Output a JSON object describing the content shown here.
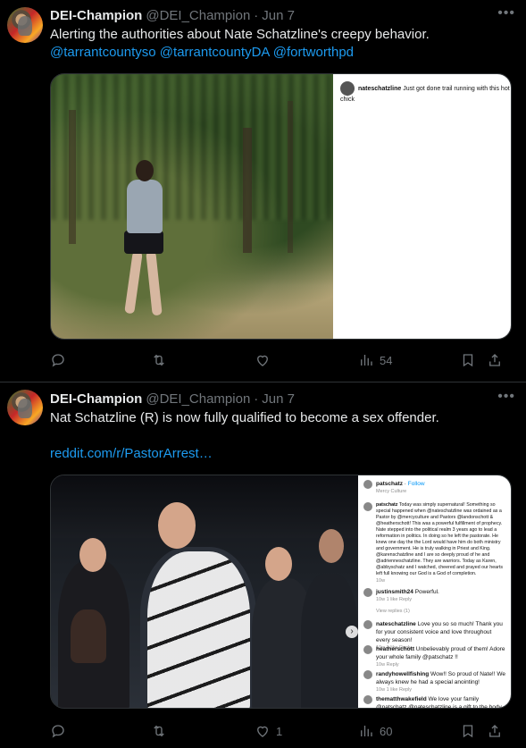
{
  "tweets": [
    {
      "author": {
        "name": "DEI-Champion",
        "handle": "@DEI_Champion",
        "separator": "·",
        "date": "Jun 7"
      },
      "text_plain": "Alerting the authorities about Nate Schatzline's creepy behavior.",
      "mentions": [
        "@tarrantcountyso",
        "@tarrantcountyDA",
        "@fortworthpd"
      ],
      "media": {
        "instagram_caption_user": "nateschatzline",
        "instagram_caption_text": "Just got done trail running with this hot chick"
      },
      "actions": {
        "reply_count": "",
        "retweet_count": "",
        "like_count": "",
        "views": "54"
      }
    },
    {
      "author": {
        "name": "DEI-Champion",
        "handle": "@DEI_Champion",
        "separator": "·",
        "date": "Jun 7"
      },
      "text_plain": "Nat Schatzline (R) is now fully qualified to become a sex offender.",
      "link": "reddit.com/r/PastorArrest…",
      "media": {
        "header_user": "patschatz",
        "header_follow": "Follow",
        "header_sub": "Mercy Culture",
        "caption_user": "patschatz",
        "caption_text": "Today was simply supernatural! Something so special happened when @nateschatzline was ordained as a Pastor by @mercyculture and Pastors @landonschott & @heatherschott! This was a powerful fulfillment of prophecy. Nate stepped into the political realm 3 years ago to lead a reformation in politics. In doing so he left the pastorate. He knew one day the the Lord would have him do both ministry and government. He is truly walking in Priest and King. @karenschatzline and I are so deeply proud of he and @adrienneschatzline. They are warriors. Today as Karen, @abbyschatz and I watched, cheered and prayed our hearts left full knowing our God is a God of completion.",
        "caption_meta": "10w",
        "comments": [
          {
            "user": "justinsmith24",
            "text": "Powerful.",
            "meta": "10w 1 like Reply"
          },
          {
            "user": "",
            "text": "View replies (1)",
            "meta": ""
          },
          {
            "user": "nateschatzline",
            "text": "Love you so so much! Thank you for your consistent voice and love throughout every season!",
            "meta": "10w 1 like Reply"
          },
          {
            "user": "heatherschott",
            "text": "Unbelievably proud of them! Adore your whole family @patschatz !!",
            "meta": "10w Reply"
          },
          {
            "user": "randyhowellfishing",
            "text": "Wow!! So proud of Nate!! We always knew he had a special anointing!",
            "meta": "10w 1 like Reply"
          },
          {
            "user": "thematthwakefield",
            "text": "We love your family @patschatz @nateschatzline is a gift to the body of Christ!",
            "meta": ""
          }
        ]
      },
      "actions": {
        "reply_count": "",
        "retweet_count": "",
        "like_count": "1",
        "views": "60"
      }
    }
  ],
  "colors": {
    "background": "#000000",
    "text": "#e7e9ea",
    "muted": "#71767b",
    "link": "#1d9bf0",
    "border": "#2f3336"
  },
  "icons": [
    "reply-icon",
    "retweet-icon",
    "like-icon",
    "views-icon",
    "bookmark-icon",
    "share-icon",
    "more-icon"
  ]
}
